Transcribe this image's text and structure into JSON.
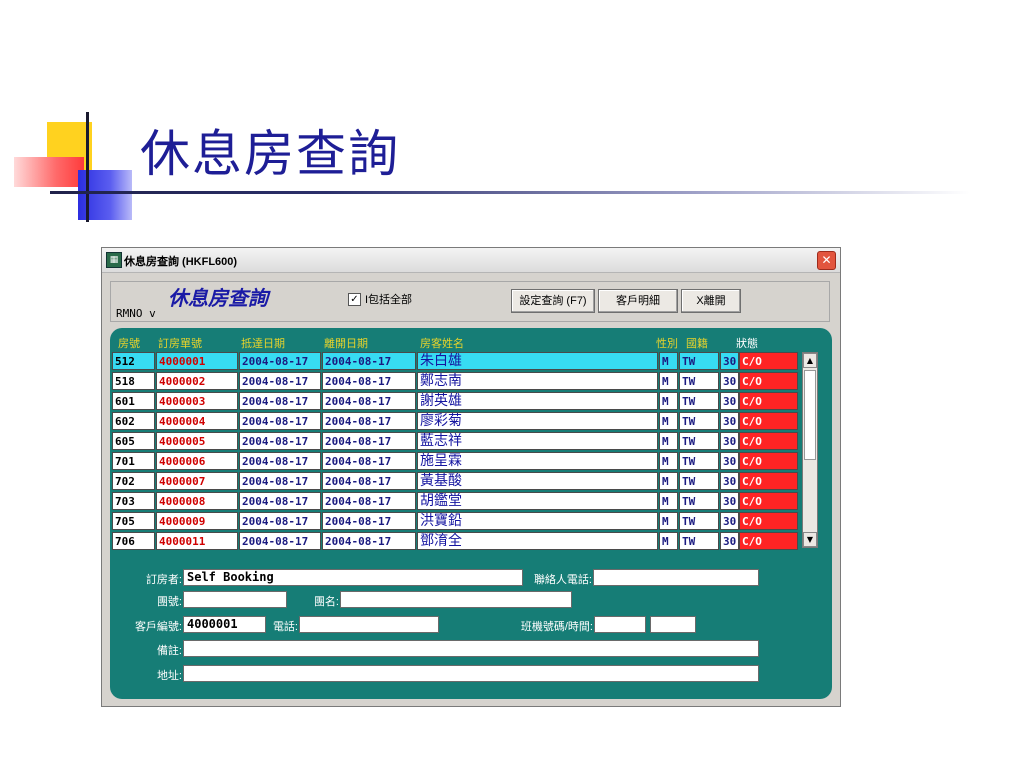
{
  "slide": {
    "title": "休息房查詢"
  },
  "window": {
    "title": "休息房查詢 (HKFL600)",
    "close_glyph": "✕",
    "form_title": "休息房查詢",
    "rmno_label": "RMNO v",
    "include_all_label": "I包括全部",
    "include_all_checked": true,
    "buttons": {
      "query": "設定查詢 (F7)",
      "detail": "客戶明細",
      "exit": "X離開"
    }
  },
  "table": {
    "headers": {
      "room": "房號",
      "order": "訂房單號",
      "arrival": "抵達日期",
      "departure": "離開日期",
      "guest": "房客姓名",
      "sex": "性別",
      "nationality": "國籍",
      "status": "狀態"
    },
    "rows": [
      {
        "room": "512",
        "order": "4000001",
        "arrival": "2004-08-17",
        "departure": "2004-08-17",
        "guest": "朱白雄",
        "sex": "M",
        "nationality": "TW",
        "count": "30",
        "status": "C/O"
      },
      {
        "room": "518",
        "order": "4000002",
        "arrival": "2004-08-17",
        "departure": "2004-08-17",
        "guest": "鄭志南",
        "sex": "M",
        "nationality": "TW",
        "count": "30",
        "status": "C/O"
      },
      {
        "room": "601",
        "order": "4000003",
        "arrival": "2004-08-17",
        "departure": "2004-08-17",
        "guest": "謝英雄",
        "sex": "M",
        "nationality": "TW",
        "count": "30",
        "status": "C/O"
      },
      {
        "room": "602",
        "order": "4000004",
        "arrival": "2004-08-17",
        "departure": "2004-08-17",
        "guest": "廖彩菊",
        "sex": "M",
        "nationality": "TW",
        "count": "30",
        "status": "C/O"
      },
      {
        "room": "605",
        "order": "4000005",
        "arrival": "2004-08-17",
        "departure": "2004-08-17",
        "guest": "藍志祥",
        "sex": "M",
        "nationality": "TW",
        "count": "30",
        "status": "C/O"
      },
      {
        "room": "701",
        "order": "4000006",
        "arrival": "2004-08-17",
        "departure": "2004-08-17",
        "guest": "施呈霖",
        "sex": "M",
        "nationality": "TW",
        "count": "30",
        "status": "C/O"
      },
      {
        "room": "702",
        "order": "4000007",
        "arrival": "2004-08-17",
        "departure": "2004-08-17",
        "guest": "黃基酸",
        "sex": "M",
        "nationality": "TW",
        "count": "30",
        "status": "C/O"
      },
      {
        "room": "703",
        "order": "4000008",
        "arrival": "2004-08-17",
        "departure": "2004-08-17",
        "guest": "胡鑑堂",
        "sex": "M",
        "nationality": "TW",
        "count": "30",
        "status": "C/O"
      },
      {
        "room": "705",
        "order": "4000009",
        "arrival": "2004-08-17",
        "departure": "2004-08-17",
        "guest": "洪寶鉛",
        "sex": "M",
        "nationality": "TW",
        "count": "30",
        "status": "C/O"
      },
      {
        "room": "706",
        "order": "4000011",
        "arrival": "2004-08-17",
        "departure": "2004-08-17",
        "guest": "鄧淯全",
        "sex": "M",
        "nationality": "TW",
        "count": "30",
        "status": "C/O"
      }
    ]
  },
  "form": {
    "booker_label": "訂房者:",
    "booker_value": "Self Booking",
    "contact_phone_label": "聯絡人電話:",
    "contact_phone_value": "",
    "group_no_label": "團號:",
    "group_no_value": "",
    "group_name_label": "團名:",
    "group_name_value": "",
    "customer_no_label": "客戶編號:",
    "customer_no_value": "4000001",
    "phone_label": "電話:",
    "phone_value": "",
    "flight_label": "班機號碼/時間:",
    "flight_no_value": "",
    "flight_time_value": "",
    "remark_label": "備註:",
    "remark_value": "",
    "address_label": "地址:",
    "address_value": ""
  },
  "colors": {
    "panel_teal": "#167d76",
    "selected_row": "#37dcf2",
    "status_red": "#ff2424",
    "title_blue": "#1e1e96"
  }
}
